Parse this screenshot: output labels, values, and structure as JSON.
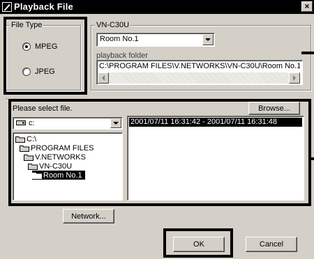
{
  "window": {
    "title": "Playback File",
    "close_glyph": "×"
  },
  "file_type": {
    "label": "File Type",
    "options": [
      {
        "label": "MPEG",
        "selected": true
      },
      {
        "label": "JPEG",
        "selected": false
      }
    ]
  },
  "device": {
    "label": "VN-C30U",
    "selected_value": "Room No.1",
    "folder_label": "playback folder",
    "folder_path": "C:\\PROGRAM FILES\\V.NETWORKS\\VN-C30U\\Room No.1"
  },
  "file_select": {
    "prompt": "Please select file.",
    "browse_label": "Browse...",
    "drive_value": "c:",
    "tree": [
      {
        "label": "C:\\",
        "selected": false
      },
      {
        "label": "PROGRAM FILES",
        "selected": false
      },
      {
        "label": "V.NETWORKS",
        "selected": false
      },
      {
        "label": "VN-C30U",
        "selected": false
      },
      {
        "label": "Room No.1",
        "selected": true
      }
    ],
    "files": [
      "2001/07/11 16:31:42 - 2001/07/11 16:31:48"
    ]
  },
  "buttons": {
    "network": "Network...",
    "ok": "OK",
    "cancel": "Cancel"
  },
  "icons": {
    "title": "playback-icon",
    "drive": "drive-icon",
    "folder": "folder-icon",
    "open_folder": "open-folder-icon",
    "dropdown": "chevron-down-icon",
    "scroll_left": "scroll-left-icon",
    "scroll_right": "scroll-right-icon",
    "close": "close-icon"
  },
  "colors": {
    "face": "#d4d0c8",
    "title_bar": "#000000",
    "selection": "#000000",
    "annotation": "#000000"
  }
}
